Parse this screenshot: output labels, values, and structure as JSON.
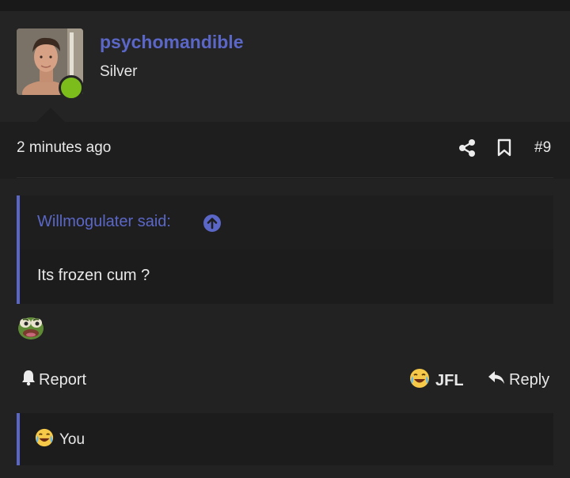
{
  "author": {
    "username": "psychomandible",
    "rank": "Silver",
    "avatar_icon": "profile-photo",
    "online": true
  },
  "meta": {
    "time": "2 minutes ago",
    "post_number": "#9"
  },
  "quote": {
    "author": "Willmogulater said:",
    "body": "Its frozen cum ?"
  },
  "reaction_icon": "pepe-emoji",
  "actions": {
    "report_label": "Report",
    "jfl_label": "JFL",
    "reply_label": "Reply"
  },
  "reactions": {
    "text": "You",
    "icon": "crying-laughing-emoji"
  },
  "colors": {
    "accent": "#5b67c7",
    "online": "#7cbd1c",
    "background": "#222222"
  }
}
